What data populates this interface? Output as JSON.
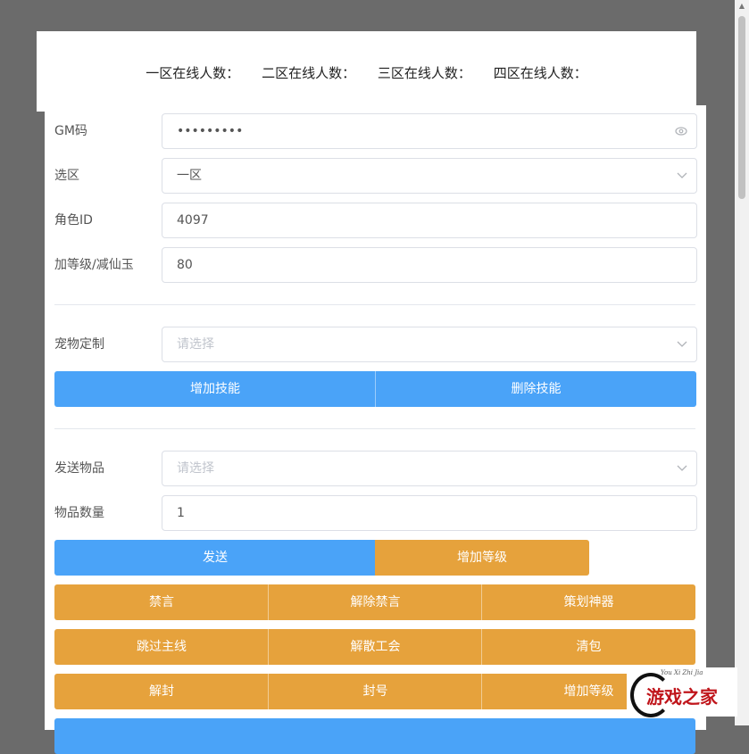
{
  "online": [
    "一区在线人数：",
    "二区在线人数：",
    "三区在线人数：",
    "四区在线人数："
  ],
  "form": {
    "gm_label": "GM码",
    "gm_value": "•••••••••",
    "zone_label": "选区",
    "zone_value": "一区",
    "role_label": "角色ID",
    "role_value": "4097",
    "level_label": "加等级/减仙玉",
    "level_value": "80"
  },
  "pet": {
    "label": "宠物定制",
    "placeholder": "请选择",
    "add_skill": "增加技能",
    "remove_skill": "删除技能"
  },
  "item": {
    "label": "发送物品",
    "placeholder": "请选择",
    "qty_label": "物品数量",
    "qty_value": "1",
    "send": "发送",
    "add_level": "增加等级"
  },
  "actions": {
    "mute": "禁言",
    "unmute": "解除禁言",
    "artifact": "策划神器",
    "skip_main": "跳过主线",
    "disband": "解散工会",
    "clear_bag": "清包",
    "unban": "解封",
    "ban": "封号",
    "add_level2": "增加等级"
  },
  "logo": {
    "small_text": "You Xi Zhi Jia",
    "main_text": "游戏之家"
  },
  "colors": {
    "blue": "#4aa3f8",
    "orange": "#e6a23c"
  }
}
